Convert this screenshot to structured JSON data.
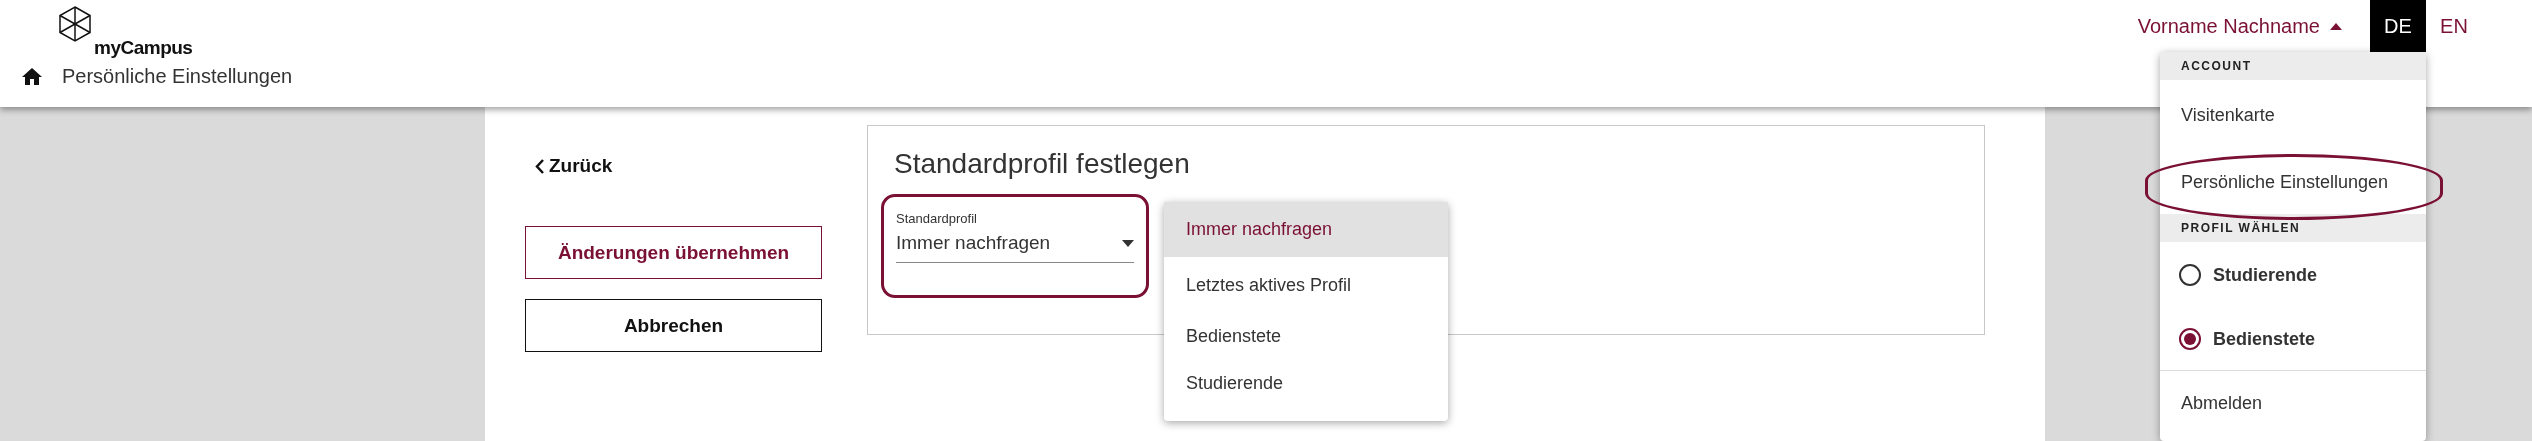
{
  "logo": {
    "text": "myCampus"
  },
  "breadcrumb": {
    "title": "Persönliche Einstellungen"
  },
  "user_menu": {
    "label": "Vorname Nachname",
    "expanded": true,
    "sections": [
      {
        "header": "ACCOUNT",
        "items": [
          {
            "kind": "link",
            "label": "Visitenkarte",
            "highlighted": false
          },
          {
            "kind": "link",
            "label": "Persönliche Einstellungen",
            "highlighted": true
          }
        ]
      },
      {
        "header": "PROFIL WÄHLEN",
        "items": [
          {
            "kind": "radio",
            "label": "Studierende",
            "selected": false
          },
          {
            "kind": "radio",
            "label": "Bedienstete",
            "selected": true
          }
        ]
      }
    ],
    "footer_items": [
      "Abmelden"
    ]
  },
  "languages": [
    {
      "label": "DE",
      "selected": true
    },
    {
      "label": "EN",
      "selected": false
    }
  ],
  "back_link": "Zurück",
  "buttons": [
    {
      "label": "Änderungen übernehmen",
      "kind": "primary"
    },
    {
      "label": "Abbrechen",
      "kind": "secondary"
    }
  ],
  "card": {
    "title": "Standardprofil festlegen",
    "select": {
      "label": "Standardprofil",
      "value": "Immer nachfragen",
      "highlighted": true,
      "expanded": true,
      "options": [
        {
          "label": "Immer nachfragen",
          "selected": true
        },
        {
          "label": "Letztes aktives Profil",
          "selected": false
        },
        {
          "label": "Bedienstete",
          "selected": false
        },
        {
          "label": "Studierende",
          "selected": false
        }
      ]
    }
  }
}
